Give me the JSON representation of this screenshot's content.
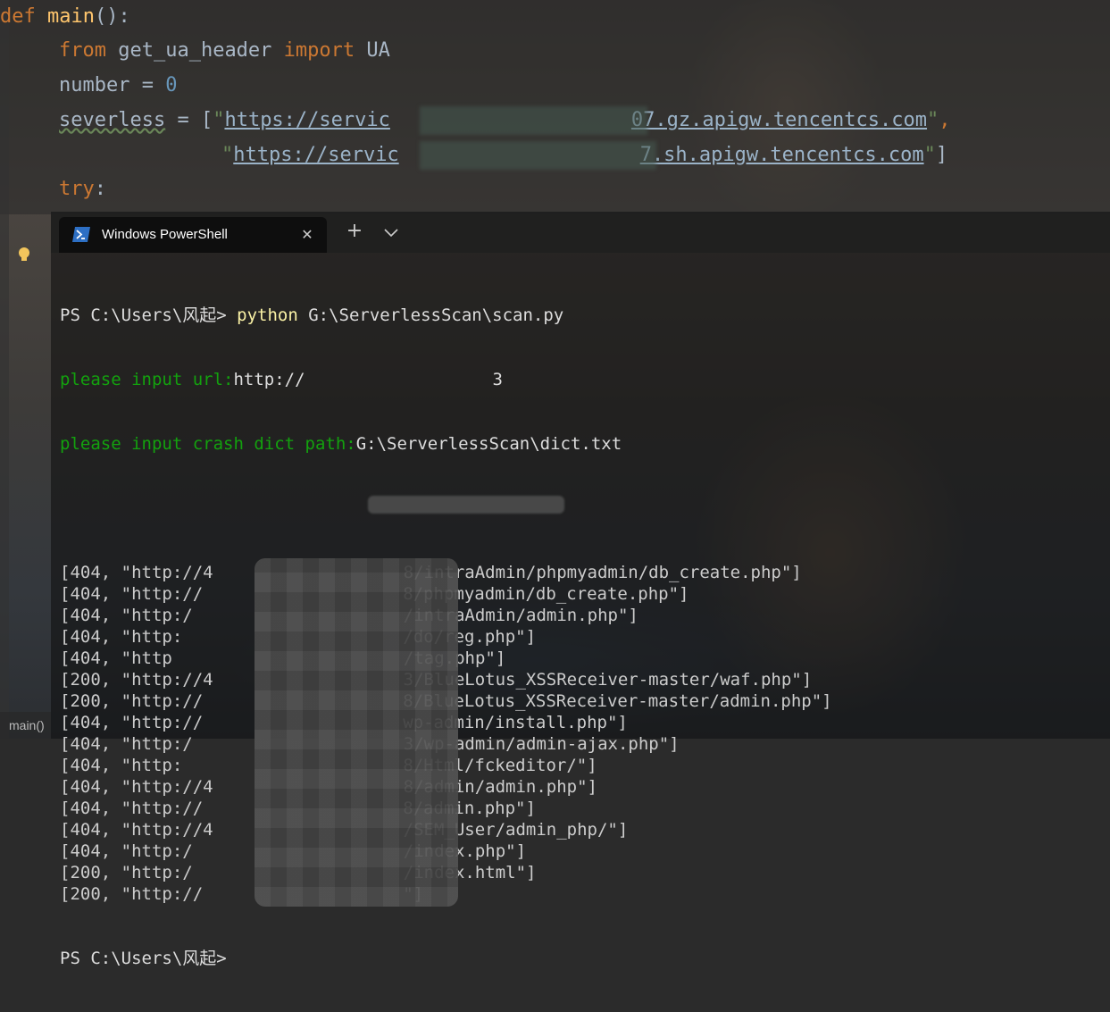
{
  "editor": {
    "lines": [
      {
        "kw": "def ",
        "fn": "main",
        "rest": "():"
      },
      {
        "kw1": "from ",
        "mid": "get_ua_header ",
        "kw2": "import ",
        "rest": "UA"
      },
      {
        "name": "number",
        "op": " = ",
        "num": "0"
      },
      {
        "name": "severless",
        "op": " = [",
        "q1": "\"",
        "url": "https://servic",
        "url_end": "07.gz.apigw.tencentcs.com",
        "q2": "\"",
        "tail": ","
      },
      {
        "q1": "\"",
        "url": "https://servic",
        "url_end": "7.sh.apigw.tencentcs.com",
        "q2": "\"",
        "tail": "]"
      },
      {
        "kw": "try",
        "rest": ":"
      }
    ]
  },
  "statusbar": {
    "label": "main()"
  },
  "terminal": {
    "tab_title": "Windows PowerShell",
    "close_glyph": "✕",
    "new_tab_glyph": "+",
    "prompt": "PS C:\\Users\\风起> ",
    "command": "python",
    "command_arg": " G:\\ServerlessScan\\scan.py",
    "url_label": "please input url:",
    "url_value": "http://",
    "url_value_tail": "3",
    "dict_label": "please input crash dict path:",
    "dict_value": "G:\\ServerlessScan\\dict.txt",
    "results": [
      {
        "code": "404",
        "host": "\"http://4",
        "path": "8/intraAdmin/phpmyadmin/db_create.php\"]"
      },
      {
        "code": "404",
        "host": "\"http://",
        "path": "8/phpmyadmin/db_create.php\"]"
      },
      {
        "code": "404",
        "host": "\"http:/",
        "path": "/intraAdmin/admin.php\"]"
      },
      {
        "code": "404",
        "host": "\"http:",
        "path": "/do/reg.php\"]"
      },
      {
        "code": "404",
        "host": "\"http",
        "path": "/tag.php\"]"
      },
      {
        "code": "200",
        "host": "\"http://4",
        "path": "3/BlueLotus_XSSReceiver-master/waf.php\"]"
      },
      {
        "code": "200",
        "host": "\"http://",
        "path": "8/BlueLotus_XSSReceiver-master/admin.php\"]"
      },
      {
        "code": "404",
        "host": "\"http://",
        "path": "wp-admin/install.php\"]"
      },
      {
        "code": "404",
        "host": "\"http:/",
        "path": "3/wp-admin/admin-ajax.php\"]"
      },
      {
        "code": "404",
        "host": "\"http:",
        "path": "8/Html/fckeditor/\"]"
      },
      {
        "code": "404",
        "host": "\"http://4",
        "path": "8/admin/admin.php\"]"
      },
      {
        "code": "404",
        "host": "\"http://",
        "path": "8/admin.php\"]"
      },
      {
        "code": "404",
        "host": "\"http://4",
        "path": "/SEM_User/admin_php/\"]"
      },
      {
        "code": "404",
        "host": "\"http:/",
        "path": "/index.php\"]"
      },
      {
        "code": "200",
        "host": "\"http:/",
        "path": "/index.html\"]"
      },
      {
        "code": "200",
        "host": "\"http://",
        "path": "\"]"
      }
    ],
    "final_prompt": "PS C:\\Users\\风起>"
  }
}
